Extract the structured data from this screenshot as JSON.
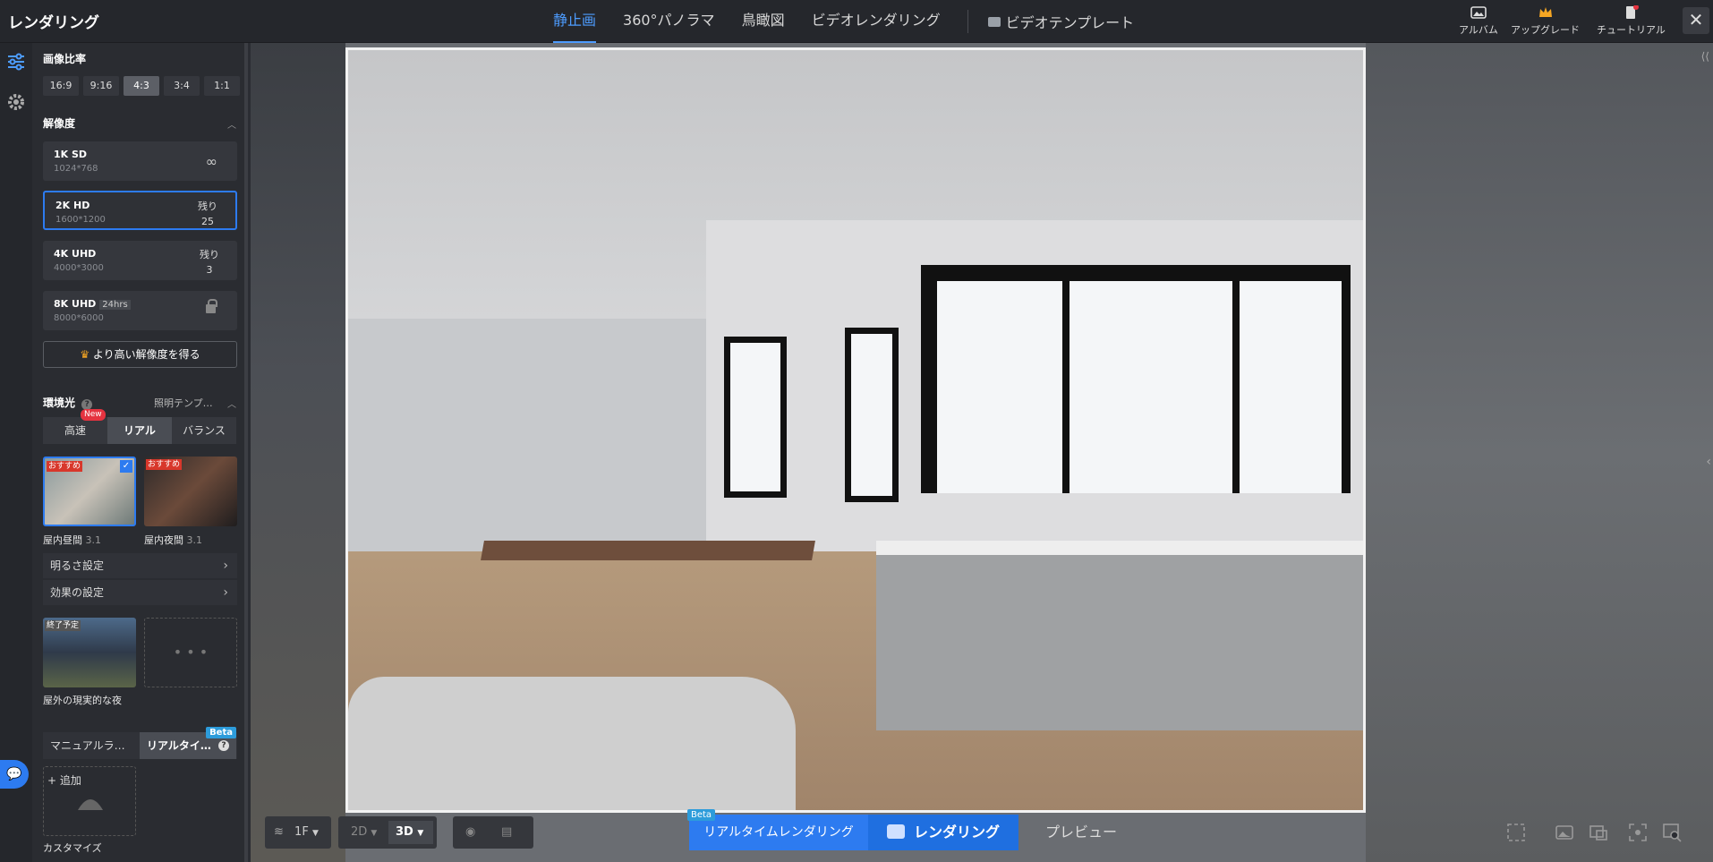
{
  "app_title": "レンダリング",
  "tabs": [
    {
      "label": "静止画",
      "active": true
    },
    {
      "label": "360°パノラマ",
      "active": false
    },
    {
      "label": "鳥瞰図",
      "active": false
    },
    {
      "label": "ビデオレンダリング",
      "active": false
    }
  ],
  "video_template": "ビデオテンプレート",
  "toolbar": {
    "album": "アルバム",
    "upgrade": "アップグレード",
    "tutorial": "チュートリアル",
    "close": "✕"
  },
  "aspect": {
    "title": "画像比率",
    "options": [
      "16:9",
      "9:16",
      "4:3",
      "3:4",
      "1:1"
    ],
    "selected": "4:3"
  },
  "resolution": {
    "title": "解像度",
    "items": [
      {
        "name": "1K SD",
        "dims": "1024*768",
        "remaining_label": "",
        "remaining": "",
        "tag": ""
      },
      {
        "name": "2K HD",
        "dims": "1600*1200",
        "remaining_label": "残り",
        "remaining": "25",
        "tag": ""
      },
      {
        "name": "4K UHD",
        "dims": "4000*3000",
        "remaining_label": "残り",
        "remaining": "3",
        "tag": ""
      },
      {
        "name": "8K UHD",
        "dims": "8000*6000",
        "remaining_label": "",
        "remaining": "",
        "tag": "24hrs"
      }
    ],
    "upgrade_button": "より高い解像度を得る"
  },
  "environment": {
    "title": "環境光",
    "template_link": "照明テンプ…",
    "modes": [
      "高速",
      "リアル",
      "バランス"
    ],
    "active_mode": "リアル",
    "new_badge": "New",
    "presets": [
      {
        "name": "屋内昼間",
        "version": "3.1",
        "badge": "おすすめ",
        "selected": true
      },
      {
        "name": "屋内夜間",
        "version": "3.1",
        "badge": "おすすめ",
        "selected": false
      }
    ],
    "brightness": "明るさ設定",
    "effects": "効果の設定",
    "outdoor": {
      "name": "屋外の現実的な夜",
      "badge": "終了予定"
    },
    "more": "• • •"
  },
  "light_modes": {
    "manual": "マニュアルラ…",
    "realtime": "リアルタイ…",
    "beta": "Beta"
  },
  "custom": {
    "add": "+ 追加",
    "label": "カスタマイズ"
  },
  "bottom": {
    "floor": "1F",
    "view_2d": "2D",
    "view_3d": "3D",
    "realtime_render": "リアルタイムレンダリング",
    "render": "レンダリング",
    "preview": "プレビュー",
    "beta": "Beta"
  },
  "colors": {
    "accent": "#2d7bf0",
    "tab_active": "#4d9cff",
    "badge_red": "#e53340"
  }
}
